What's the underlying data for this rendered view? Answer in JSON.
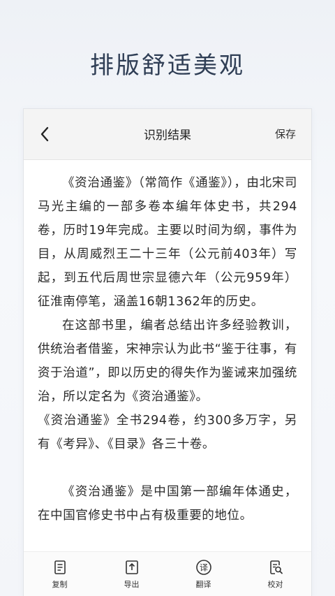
{
  "headline": "排版舒适美观",
  "nav": {
    "title": "识别结果",
    "save_label": "保存",
    "back_icon": "chevron-left-icon"
  },
  "paragraphs": {
    "p1": "《资治通鉴》（常简作《通鉴》），由北宋司马光主编的一部多卷本编年体史书，共294卷，历时19年完成。主要以时间为纲，事件为目，从周威烈王二十三年（公元前403年）写起，到五代后周世宗显德六年（公元959年）征淮南停笔，涵盖16朝1362年的历史。",
    "p2": "在这部书里，编者总结出许多经验教训，供统治者借鉴，宋神宗认为此书“鉴于往事，有资于治道”，即以历史的得失作为鉴诫来加强统治，所以定名为《资治通鉴》。",
    "p3": "《资治通鉴》全书294卷，约300多万字，另有《考异》、《目录》各三十卷。",
    "p4": "《资治通鉴》是中国第一部编年体通史，在中国官修史书中占有极重要的地位。"
  },
  "toolbar": {
    "copy_label": "复制",
    "export_label": "导出",
    "translate_label": "翻译",
    "proofread_label": "校对",
    "translate_glyph": "译"
  },
  "colors": {
    "headline": "#2f3e55",
    "text": "#2a2a2a",
    "nav_bg": "#f4f4f4"
  }
}
